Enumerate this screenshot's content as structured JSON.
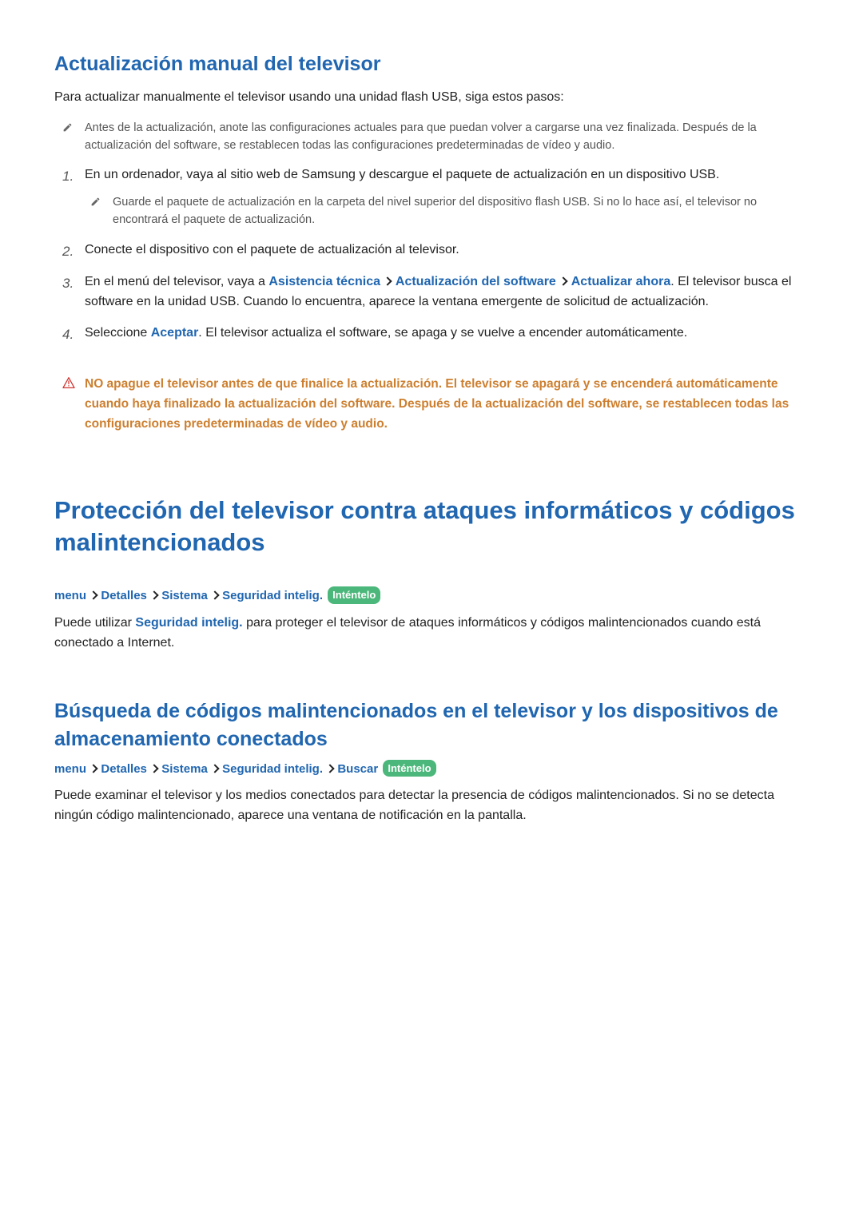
{
  "section1": {
    "heading": "Actualización manual del televisor",
    "intro": "Para actualizar manualmente el televisor usando una unidad flash USB, siga estos pasos:",
    "note1": "Antes de la actualización, anote las configuraciones actuales para que puedan volver a cargarse una vez finalizada. Después de la actualización del software, se restablecen todas las configuraciones predeterminadas de vídeo y audio.",
    "step1": {
      "num": "1.",
      "text": "En un ordenador, vaya al sitio web de Samsung y descargue el paquete de actualización en un dispositivo USB."
    },
    "note2": "Guarde el paquete de actualización en la carpeta del nivel superior del dispositivo flash USB. Si no lo hace así, el televisor no encontrará el paquete de actualización.",
    "step2": {
      "num": "2.",
      "text": "Conecte el dispositivo con el paquete de actualización al televisor."
    },
    "step3": {
      "num": "3.",
      "prefix": "En el menú del televisor, vaya a ",
      "link1": "Asistencia técnica",
      "link2": "Actualización del software",
      "link3": "Actualizar ahora",
      "suffix": ". El televisor busca el software en la unidad USB. Cuando lo encuentra, aparece la ventana emergente de solicitud de actualización."
    },
    "step4": {
      "num": "4.",
      "prefix": "Seleccione ",
      "link1": "Aceptar",
      "suffix": ". El televisor actualiza el software, se apaga y se vuelve a encender automáticamente."
    },
    "warning": "NO apague el televisor antes de que finalice la actualización. El televisor se apagará y se encenderá automáticamente cuando haya finalizado la actualización del software. Después de la actualización del software, se restablecen todas las configuraciones predeterminadas de vídeo y audio."
  },
  "section2": {
    "heading": "Protección del televisor contra ataques informáticos y códigos malintencionados",
    "breadcrumb": {
      "p1": "menu",
      "p2": "Detalles",
      "p3": "Sistema",
      "p4": "Seguridad intelig.",
      "try": "Inténtelo"
    },
    "body": {
      "prefix": "Puede utilizar ",
      "link": "Seguridad intelig.",
      "suffix": " para proteger el televisor de ataques informáticos y códigos malintencionados cuando está conectado a Internet."
    }
  },
  "section3": {
    "heading": "Búsqueda de códigos malintencionados en el televisor y los dispositivos de almacenamiento conectados",
    "breadcrumb": {
      "p1": "menu",
      "p2": "Detalles",
      "p3": "Sistema",
      "p4": "Seguridad intelig.",
      "p5": "Buscar",
      "try": "Inténtelo"
    },
    "body": "Puede examinar el televisor y los medios conectados para detectar la presencia de códigos malintencionados. Si no se detecta ningún código malintencionado, aparece una ventana de notificación en la pantalla."
  }
}
